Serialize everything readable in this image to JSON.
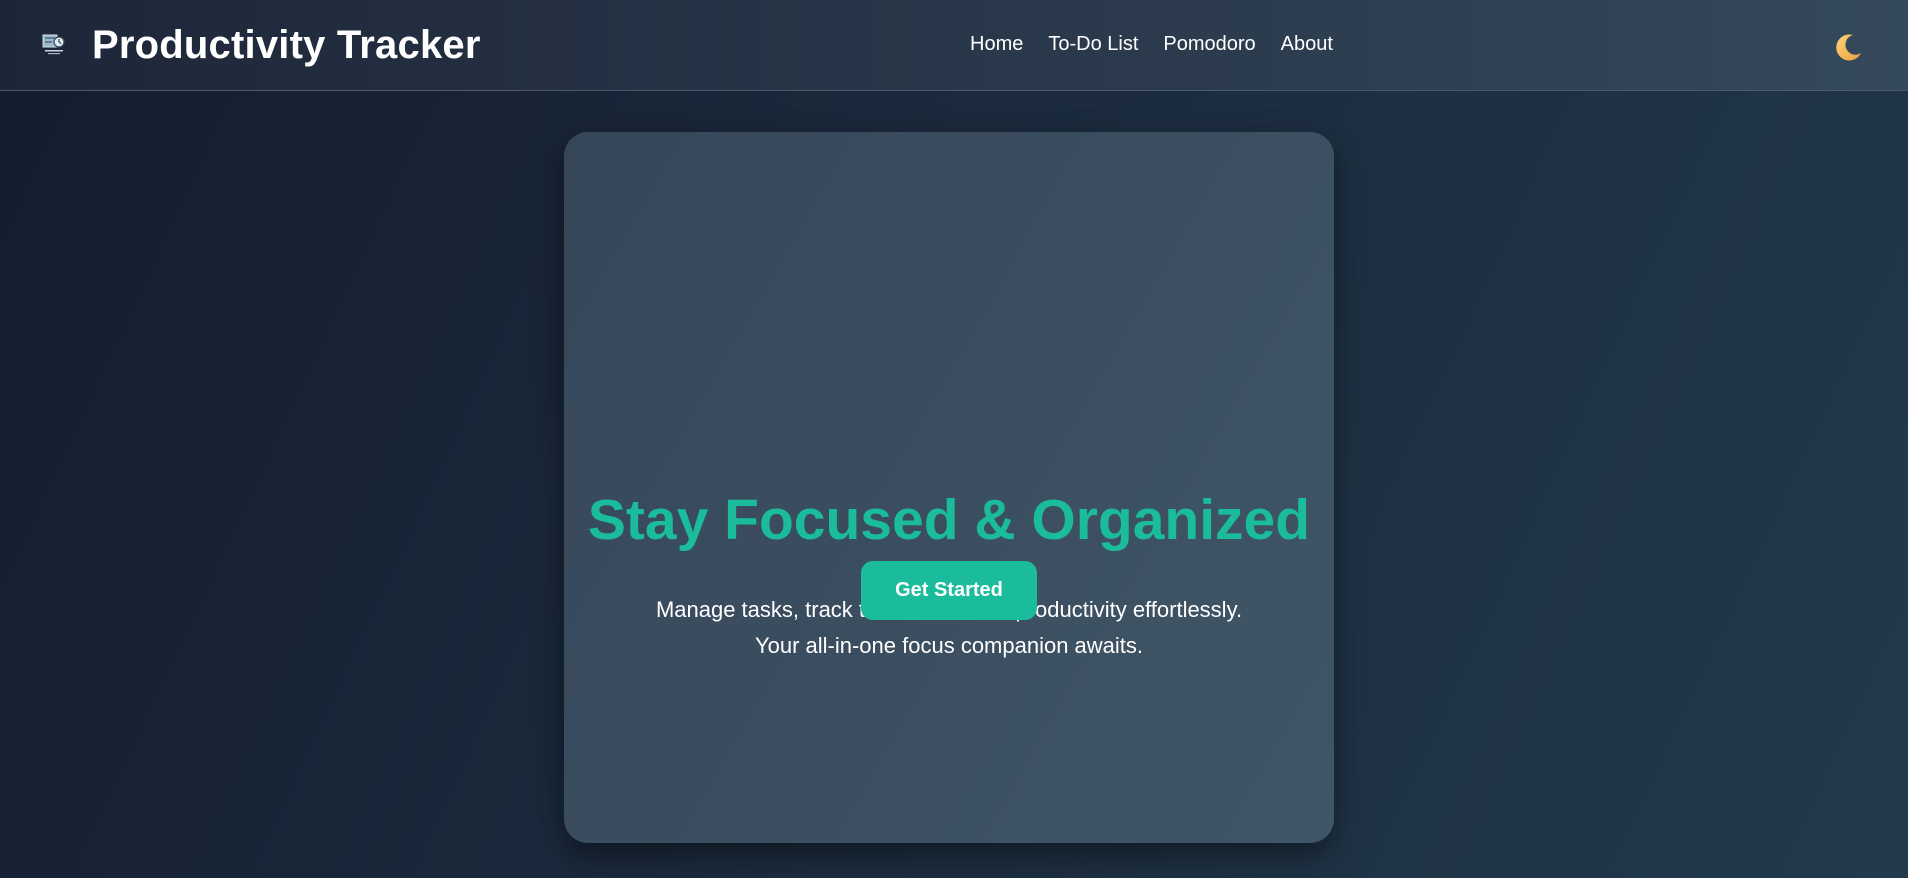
{
  "app": {
    "title": "Productivity Tracker",
    "logo_icon": "productivity-tracker-logo-icon"
  },
  "nav": {
    "items": [
      {
        "label": "Home"
      },
      {
        "label": "To-Do List"
      },
      {
        "label": "Pomodoro"
      },
      {
        "label": "About"
      }
    ],
    "theme_toggle_icon": "moon-icon"
  },
  "hero": {
    "title": "Stay Focused & Organized",
    "description_line1": "Manage tasks, track time, and boost productivity effortlessly.",
    "description_line2": "Your all-in-one focus companion awaits.",
    "cta_label": "Get Started"
  },
  "colors": {
    "accent": "#1abc9c",
    "background_dark": "#141d2e",
    "card": "#3b4e60",
    "moon": "#f5b942"
  }
}
